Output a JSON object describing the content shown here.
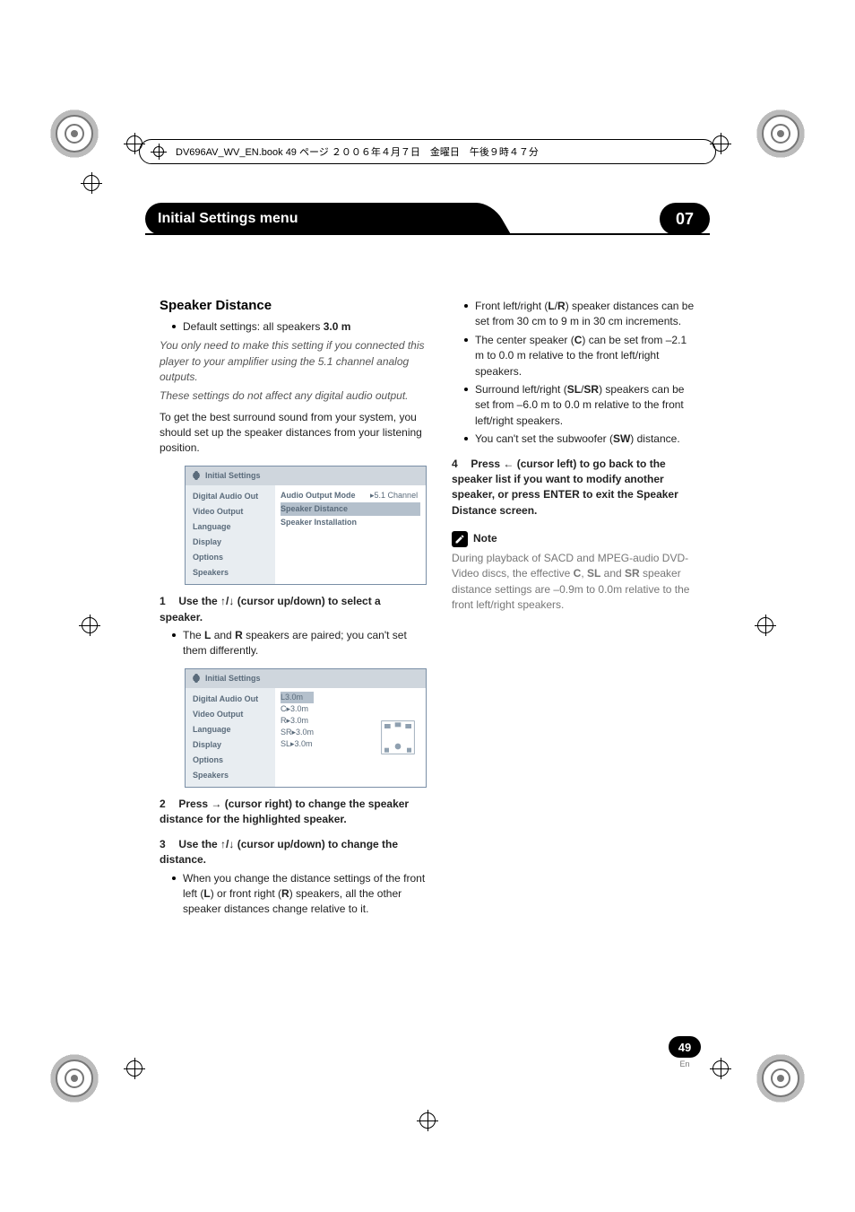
{
  "header": {
    "book_info": "DV696AV_WV_EN.book  49 ページ  ２００６年４月７日　金曜日　午後９時４７分"
  },
  "tab_bar": {
    "title": "Initial Settings menu",
    "chapter": "07"
  },
  "left_column": {
    "section_title": "Speaker Distance",
    "default_prefix": "Default settings: all speakers ",
    "default_value": "3.0 m",
    "italic_1": "You only need to make this setting if you connected this player to your amplifier using the 5.1 channel analog outputs.",
    "italic_2": "These settings do not affect any digital audio output.",
    "para_1": "To get the best surround sound from your system, you should set up the speaker distances from your listening position.",
    "osd1": {
      "title": "Initial Settings",
      "left_items": [
        "Digital Audio Out",
        "Video Output",
        "Language",
        "Display",
        "Options",
        "Speakers"
      ],
      "right_rows": [
        {
          "label": "Audio Output Mode",
          "value": "5.1 Channel"
        },
        {
          "label": "Speaker Distance",
          "value": ""
        },
        {
          "label": "Speaker Installation",
          "value": ""
        }
      ]
    },
    "step1": "Use the ↑/↓ (cursor up/down) to select a speaker.",
    "step1_num": "1",
    "bullet_lr_1": "The ",
    "bullet_lr_l": "L",
    "bullet_lr_2": " and ",
    "bullet_lr_r": "R",
    "bullet_lr_3": " speakers are paired; you can't set them differently.",
    "osd2": {
      "title": "Initial Settings",
      "left_items": [
        "Digital Audio Out",
        "Video Output",
        "Language",
        "Display",
        "Options",
        "Speakers"
      ],
      "dist_rows": [
        {
          "ch": "L",
          "val": "3.0m"
        },
        {
          "ch": "C",
          "val": "3.0m"
        },
        {
          "ch": "R",
          "val": "3.0m"
        },
        {
          "ch": "SR",
          "val": "3.0m"
        },
        {
          "ch": "SL",
          "val": "3.0m"
        }
      ]
    },
    "step2_num": "2",
    "step2": "Press → (cursor right) to change the speaker distance for the highlighted speaker.",
    "step3_num": "3",
    "step3": "Use the ↑/↓ (cursor up/down) to change the distance.",
    "bullet3_1": "When you change the distance settings of the front left (",
    "bullet3_l": "L",
    "bullet3_2": ") or front right (",
    "bullet3_r": "R",
    "bullet3_3": ") speakers, all the other speaker distances change relative to it."
  },
  "right_column": {
    "bullets": [
      {
        "pre": "Front left/right (",
        "b1": "L",
        "mid1": "/",
        "b2": "R",
        "post": ") speaker distances can be set from 30 cm to 9 m in 30 cm increments."
      },
      {
        "pre": "The center speaker (",
        "b1": "C",
        "mid1": "",
        "b2": "",
        "post": ") can be set from –2.1 m to 0.0 m relative to the front left/right speakers."
      },
      {
        "pre": "Surround left/right (",
        "b1": "SL",
        "mid1": "/",
        "b2": "SR",
        "post": ") speakers can be set from –6.0 m to 0.0 m relative to the front left/right speakers."
      },
      {
        "pre": "You can't set the subwoofer (",
        "b1": "SW",
        "mid1": "",
        "b2": "",
        "post": ") distance."
      }
    ],
    "step4_num": "4",
    "step4": "Press ← (cursor left) to go back to the speaker list if you want to modify another speaker, or press ENTER to exit the Speaker Distance screen.",
    "note_label": "Note",
    "note_text_1": "During playback of SACD and MPEG-audio DVD-Video discs, the effective ",
    "note_c": "C",
    "note_text_2": ", ",
    "note_sl": "SL",
    "note_text_3": " and ",
    "note_sr": "SR",
    "note_text_4": " speaker distance settings are –0.9m to 0.0m relative to the front left/right speakers."
  },
  "footer": {
    "page_number": "49",
    "lang": "En"
  }
}
